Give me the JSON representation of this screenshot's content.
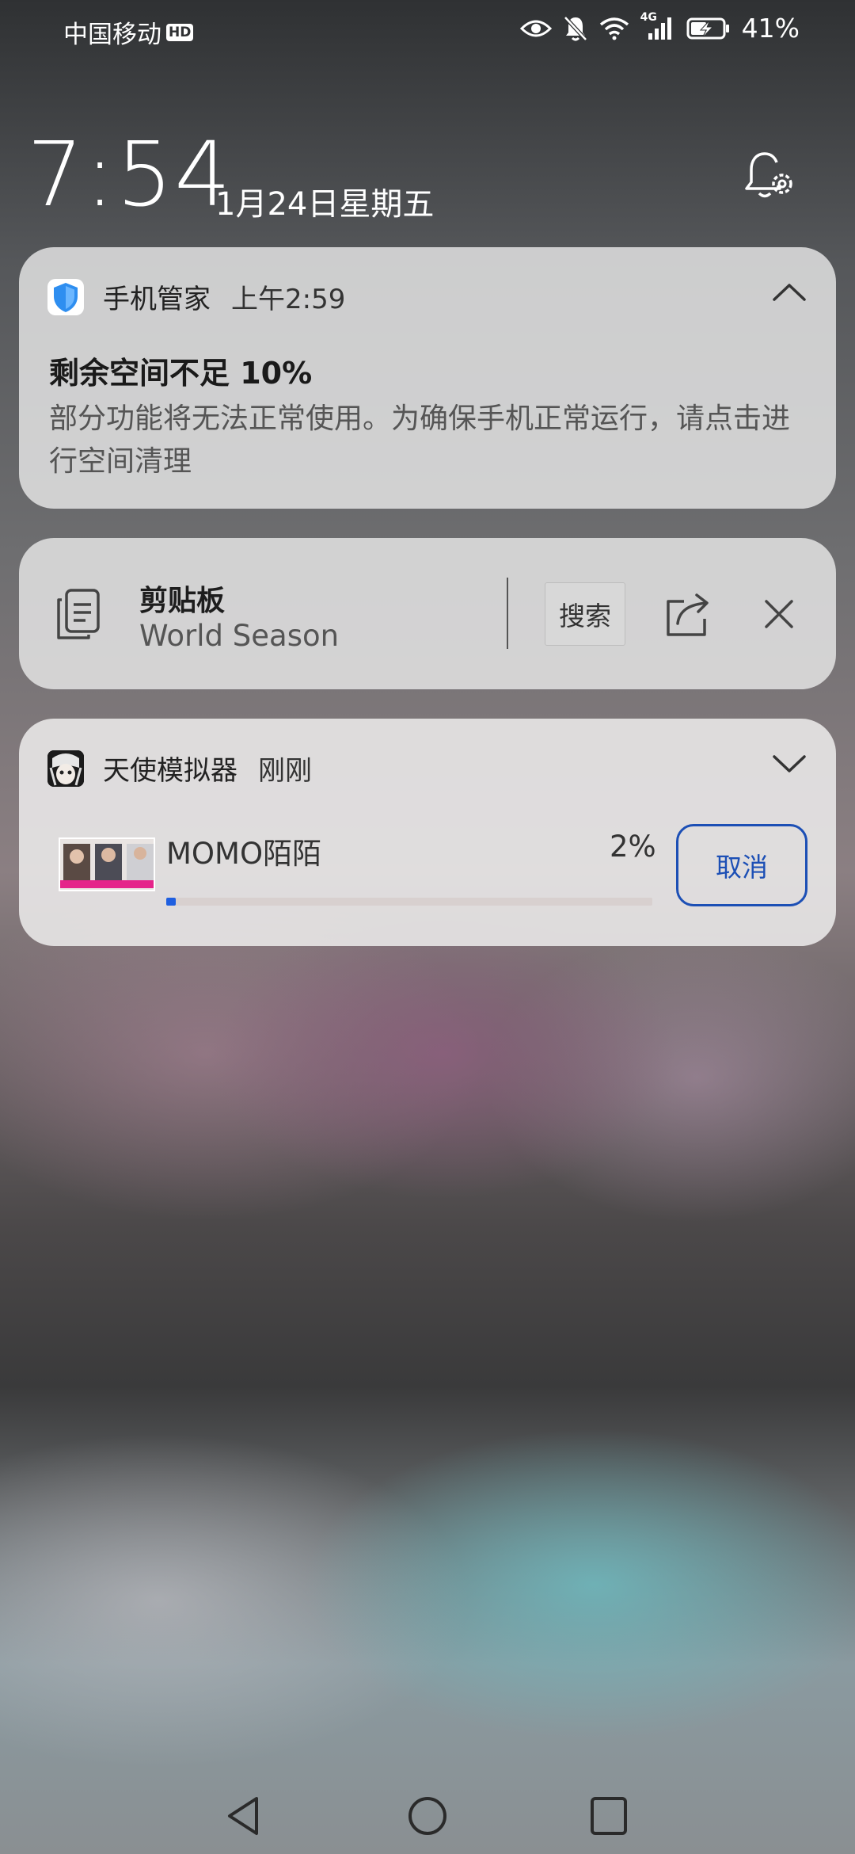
{
  "status_bar": {
    "carrier": "中国移动",
    "hd": "HD",
    "network": "4G",
    "battery": "41%",
    "icons": [
      "eye-icon",
      "bell-muted-icon",
      "wifi-icon",
      "signal-icon",
      "battery-charging-icon"
    ]
  },
  "lock": {
    "time": "7:54",
    "date": "1月24日星期五"
  },
  "notifications": [
    {
      "app": "手机管家",
      "time": "上午2:59",
      "title": "剩余空间不足 10%",
      "body": "部分功能将无法正常使用。为确保手机正常运行，请点击进行空间清理",
      "expanded": true
    }
  ],
  "clipboard": {
    "title": "剪贴板",
    "text": "World Season",
    "search_label": "搜索"
  },
  "download": {
    "app": "天使模拟器",
    "time": "刚刚",
    "file_name": "MOMO陌陌",
    "progress_text": "2%",
    "progress": 0.02,
    "cancel_label": "取消"
  },
  "colors": {
    "accent": "#1c4fb5",
    "progress_fill": "#1f5fe0",
    "card_bg": "#e8e8e8"
  }
}
